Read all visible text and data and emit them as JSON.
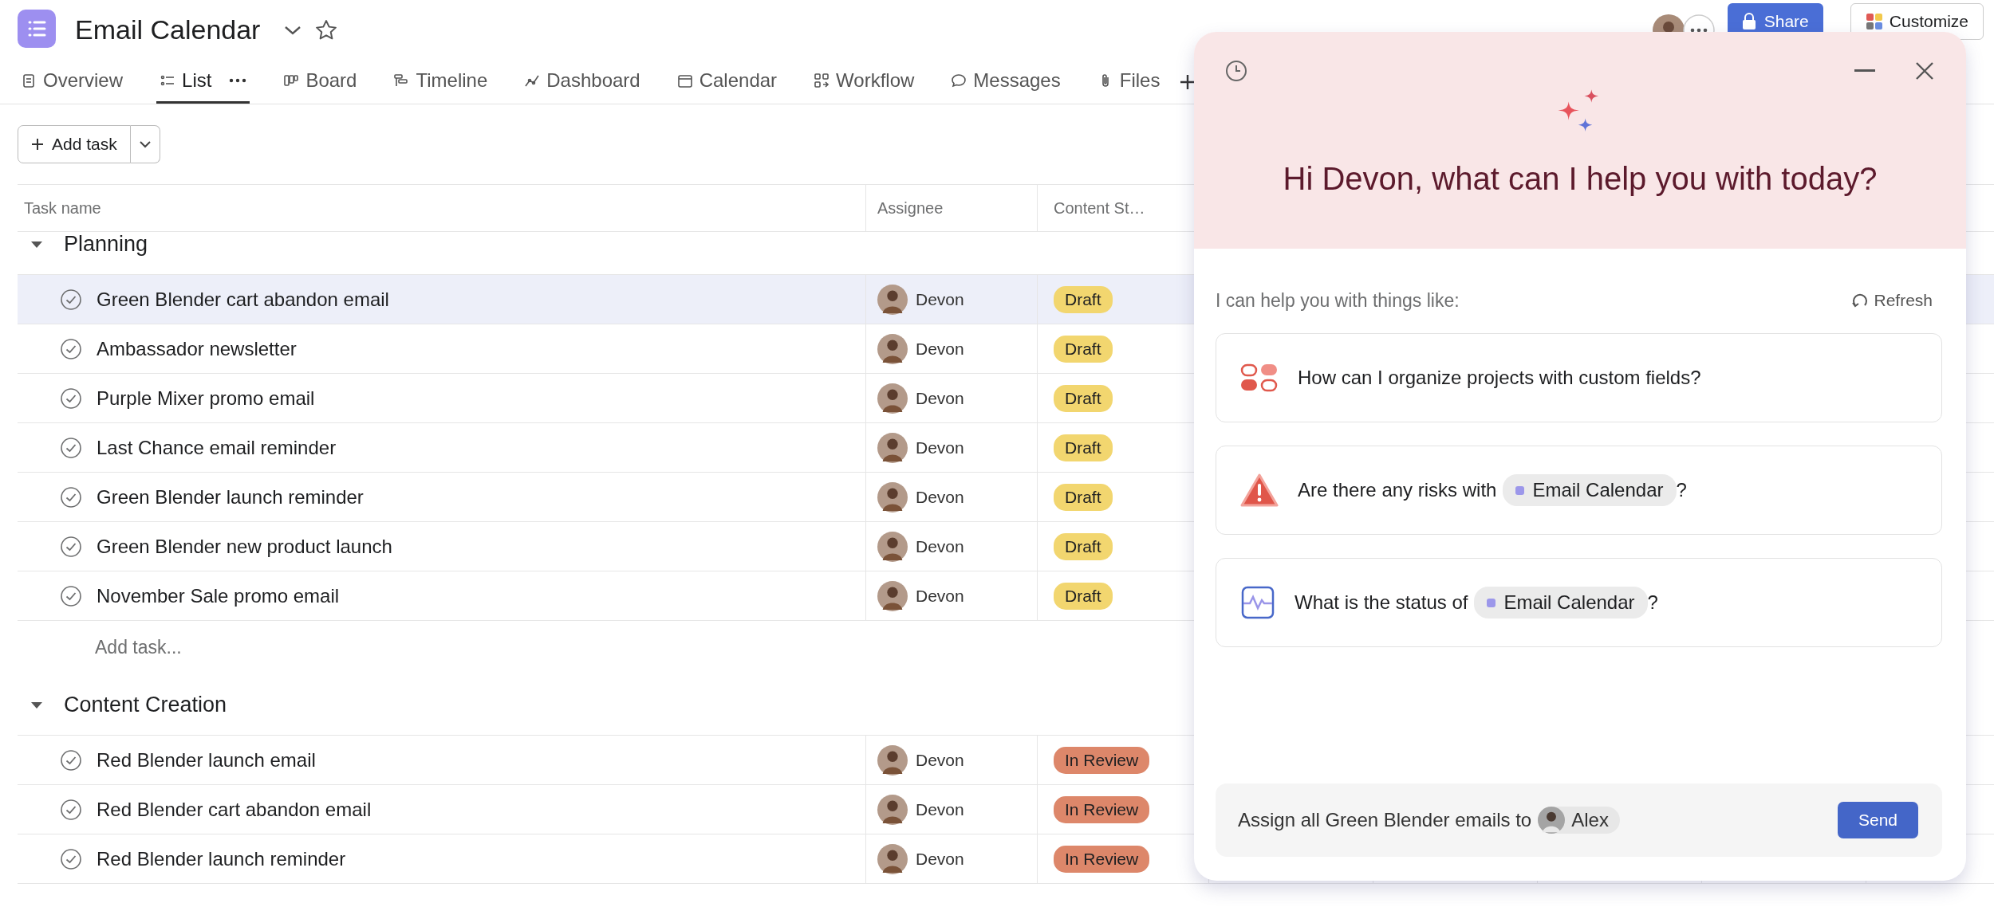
{
  "project": {
    "title": "Email Calendar"
  },
  "tabs": [
    {
      "label": "Overview",
      "kind": "overview",
      "selected": false
    },
    {
      "label": "List",
      "kind": "list",
      "selected": true
    },
    {
      "label": "Board",
      "kind": "board",
      "selected": false
    },
    {
      "label": "Timeline",
      "kind": "timeline",
      "selected": false
    },
    {
      "label": "Dashboard",
      "kind": "dashboard",
      "selected": false
    },
    {
      "label": "Calendar",
      "kind": "calendar",
      "selected": false
    },
    {
      "label": "Workflow",
      "kind": "workflow",
      "selected": false
    },
    {
      "label": "Messages",
      "kind": "messages",
      "selected": false
    },
    {
      "label": "Files",
      "kind": "files",
      "selected": false
    }
  ],
  "header_actions": {
    "share": "Share",
    "customize": "Customize"
  },
  "toolbar": {
    "add_task": "Add task"
  },
  "table": {
    "columns": [
      "Task name",
      "Assignee",
      "Content St…"
    ],
    "groups": [
      {
        "name": "Planning",
        "expanded": true,
        "add_task": "Add task...",
        "rows": [
          {
            "task": "Green Blender cart abandon email",
            "completed": false,
            "selected": true,
            "assignee": "Devon",
            "status": {
              "label": "Draft",
              "color": "#f2d66f"
            }
          },
          {
            "task": "Ambassador newsletter",
            "completed": false,
            "selected": false,
            "assignee": "Devon",
            "status": {
              "label": "Draft",
              "color": "#f2d66f"
            }
          },
          {
            "task": "Purple Mixer promo email",
            "completed": false,
            "selected": false,
            "assignee": "Devon",
            "status": {
              "label": "Draft",
              "color": "#f2d66f"
            }
          },
          {
            "task": "Last Chance email reminder",
            "completed": false,
            "selected": false,
            "assignee": "Devon",
            "status": {
              "label": "Draft",
              "color": "#f2d66f"
            }
          },
          {
            "task": "Green Blender launch reminder",
            "completed": false,
            "selected": false,
            "assignee": "Devon",
            "status": {
              "label": "Draft",
              "color": "#f2d66f"
            }
          },
          {
            "task": "Green Blender new product launch",
            "completed": false,
            "selected": false,
            "assignee": "Devon",
            "status": {
              "label": "Draft",
              "color": "#f2d66f"
            }
          },
          {
            "task": "November Sale promo email",
            "completed": false,
            "selected": false,
            "assignee": "Devon",
            "status": {
              "label": "Draft",
              "color": "#f2d66f"
            }
          }
        ]
      },
      {
        "name": "Content Creation",
        "expanded": true,
        "rows": [
          {
            "task": "Red Blender launch email",
            "completed": false,
            "selected": false,
            "assignee": "Devon",
            "status": {
              "label": "In Review",
              "color": "#dd876a"
            }
          },
          {
            "task": "Red Blender cart abandon email",
            "completed": false,
            "selected": false,
            "assignee": "Devon",
            "status": {
              "label": "In Review",
              "color": "#dd876a"
            }
          },
          {
            "task": "Red Blender launch reminder",
            "completed": false,
            "selected": false,
            "assignee": "Devon",
            "status": {
              "label": "In Review",
              "color": "#dd876a"
            }
          }
        ]
      }
    ]
  },
  "assistant": {
    "greeting": "Hi Devon, what can I help you with today?",
    "intro": "I can help you with things like:",
    "refresh": "Refresh",
    "suggestions": [
      {
        "kind": "fields",
        "text": "How can I organize projects with custom fields?"
      },
      {
        "kind": "risk",
        "text": "Are there any risks with",
        "chip": {
          "label": "Email Calendar",
          "color": "#9c97ea"
        },
        "after": "?"
      },
      {
        "kind": "status",
        "text": "What is the status of",
        "chip": {
          "label": "Email Calendar",
          "color": "#9c97ea"
        },
        "after": "?"
      }
    ],
    "prompt": {
      "value": "Assign all Green Blender emails to",
      "mention": "Alex"
    },
    "send": "Send"
  }
}
